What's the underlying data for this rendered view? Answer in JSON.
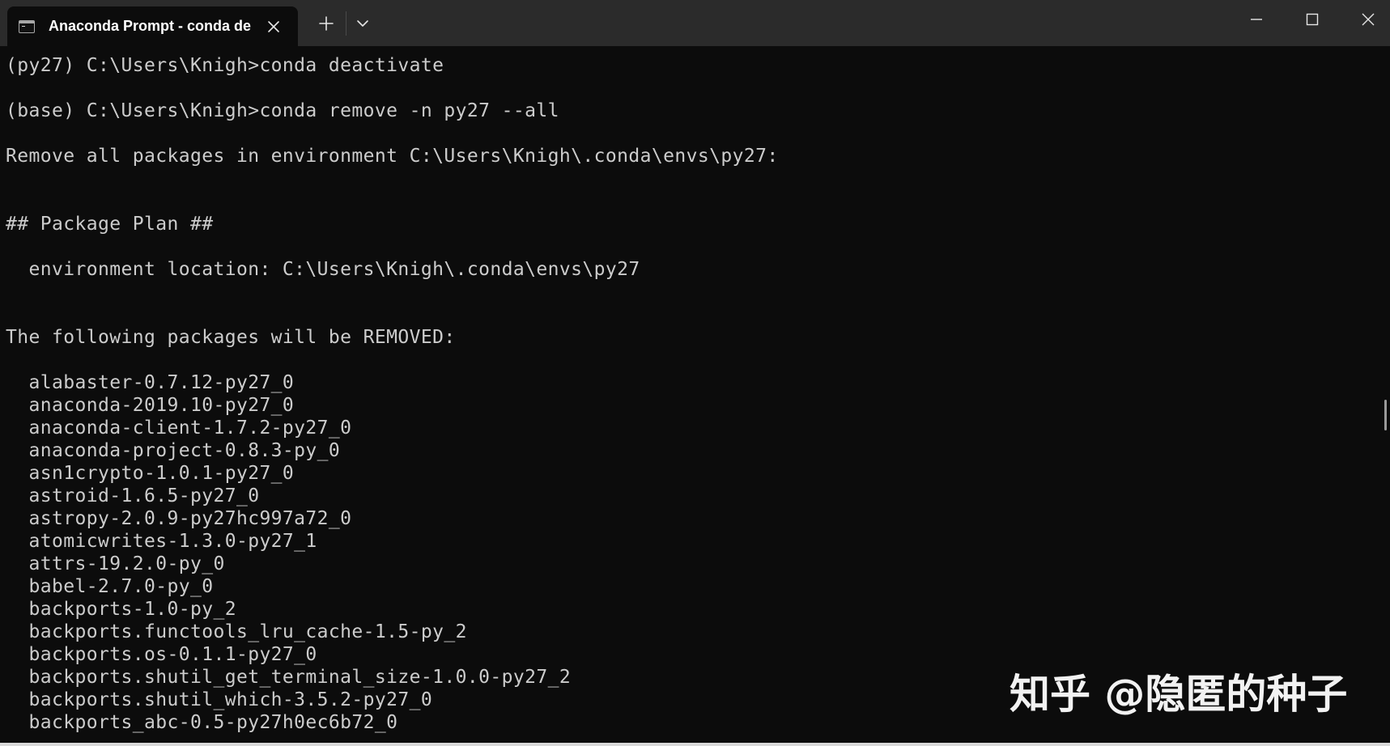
{
  "window": {
    "tab_title": "Anaconda Prompt - conda  de",
    "tab_icon": "terminal-icon",
    "close_tab_icon": "close-icon",
    "new_tab_icon": "plus-icon",
    "dropdown_icon": "chevron-down-icon",
    "minimize_icon": "minimize-icon",
    "maximize_icon": "maximize-icon",
    "close_window_icon": "close-icon"
  },
  "terminal": {
    "lines": [
      "(py27) C:\\Users\\Knigh>conda deactivate",
      "",
      "(base) C:\\Users\\Knigh>conda remove -n py27 --all",
      "",
      "Remove all packages in environment C:\\Users\\Knigh\\.conda\\envs\\py27:",
      "",
      "",
      "## Package Plan ##",
      "",
      "  environment location: C:\\Users\\Knigh\\.conda\\envs\\py27",
      "",
      "",
      "The following packages will be REMOVED:",
      "",
      "  alabaster-0.7.12-py27_0",
      "  anaconda-2019.10-py27_0",
      "  anaconda-client-1.7.2-py27_0",
      "  anaconda-project-0.8.3-py_0",
      "  asn1crypto-1.0.1-py27_0",
      "  astroid-1.6.5-py27_0",
      "  astropy-2.0.9-py27hc997a72_0",
      "  atomicwrites-1.3.0-py27_1",
      "  attrs-19.2.0-py_0",
      "  babel-2.7.0-py_0",
      "  backports-1.0-py_2",
      "  backports.functools_lru_cache-1.5-py_2",
      "  backports.os-0.1.1-py27_0",
      "  backports.shutil_get_terminal_size-1.0.0-py27_2",
      "  backports.shutil_which-3.5.2-py27_0",
      "  backports_abc-0.5-py27h0ec6b72_0"
    ]
  },
  "watermark": {
    "text": "知乎 @隐匿的种子"
  },
  "colors": {
    "titlebar": "#2b2b2b",
    "terminal_bg": "#0c0c0c",
    "terminal_fg": "#cccccc"
  }
}
